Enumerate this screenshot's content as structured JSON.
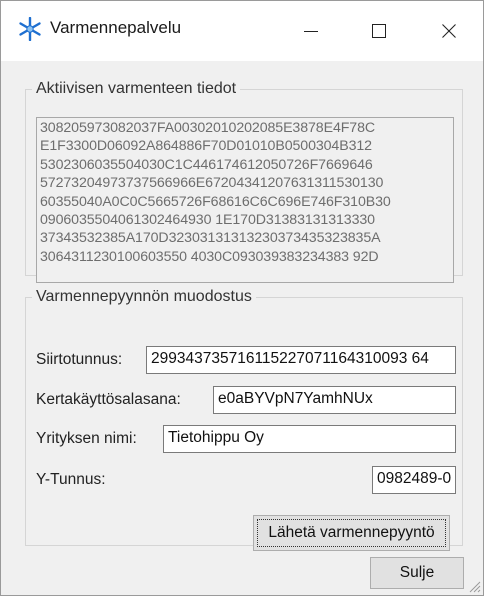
{
  "window": {
    "title": "Varmennepalvelu"
  },
  "titlebar_buttons": {
    "minimize": "minimize-icon",
    "maximize": "maximize-icon",
    "close": "close-icon"
  },
  "certificate": {
    "legend": "Aktiivisen varmenteen tiedot",
    "lines": [
      "308205973082037FA00302010202085E3878E4F78C",
      "E1F3300D06092A864886F70D01010B0500304B312",
      "5302306035504030C1C446174612050726F7669646",
      "57273204973737566966E67204341207631311530130",
      "60355040A0C0C5665726F68616C6C696E746F310B30",
      "0906035504061302464930 1E170D31383131313330",
      "37343532385A170D32303131313230373435323835A",
      "3064311230100603550 4030C093039383234383 92D"
    ]
  },
  "request": {
    "legend": "Varmennepyynnön muodostus",
    "transfer_id_label": "Siirtotunnus:",
    "transfer_id_value": "299343735716115227071164310093 64",
    "otp_label": "Kertakäyttösalasana:",
    "otp_value": "e0aBYVpN7YamhNUx",
    "company_label": "Yrityksen nimi:",
    "company_value": "Tietohippu Oy",
    "ytunnus_label": "Y-Tunnus:",
    "ytunnus_value": "0982489-0",
    "send_button": "Lähetä varmennepyyntö"
  },
  "footer": {
    "close_button": "Sulje"
  },
  "colors": {
    "window_bg": "#f0f0f0",
    "titlebar_bg": "#ffffff",
    "icon_accent": "#1e6fd0",
    "disabled_text": "#6d6d6d"
  }
}
